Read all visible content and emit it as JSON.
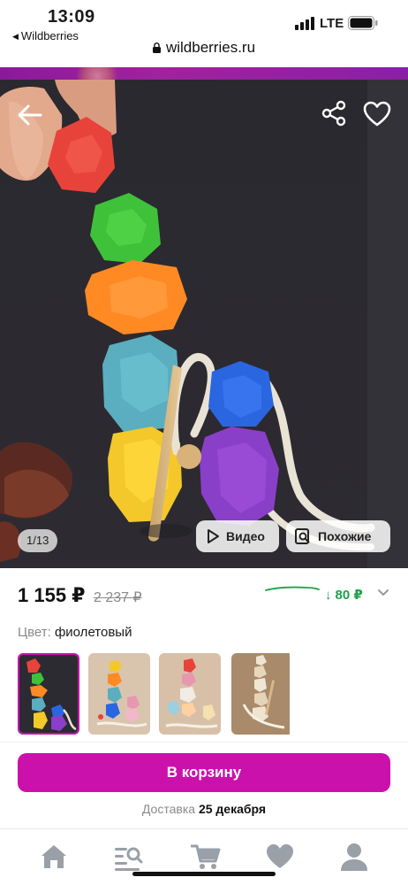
{
  "status_bar": {
    "time": "13:09",
    "back_app": "Wildberries",
    "network": "LTE",
    "url": "wildberries.ru"
  },
  "gallery": {
    "counter": "1/13",
    "video_label": "Видео",
    "similar_label": "Похожие"
  },
  "price": {
    "current": "1 155 ₽",
    "old": "2 237 ₽",
    "drop": "80 ₽",
    "drop_color": "#1aa24a"
  },
  "color": {
    "label": "Цвет:",
    "value": "фиолетовый"
  },
  "cart": {
    "button_label": "В корзину",
    "delivery_label": "Доставка",
    "delivery_date": "25 декабря",
    "accent": "#cb11ab"
  },
  "tabbar": {
    "items": [
      "home-icon",
      "catalog-search-icon",
      "cart-icon",
      "favorites-icon",
      "profile-icon"
    ]
  }
}
